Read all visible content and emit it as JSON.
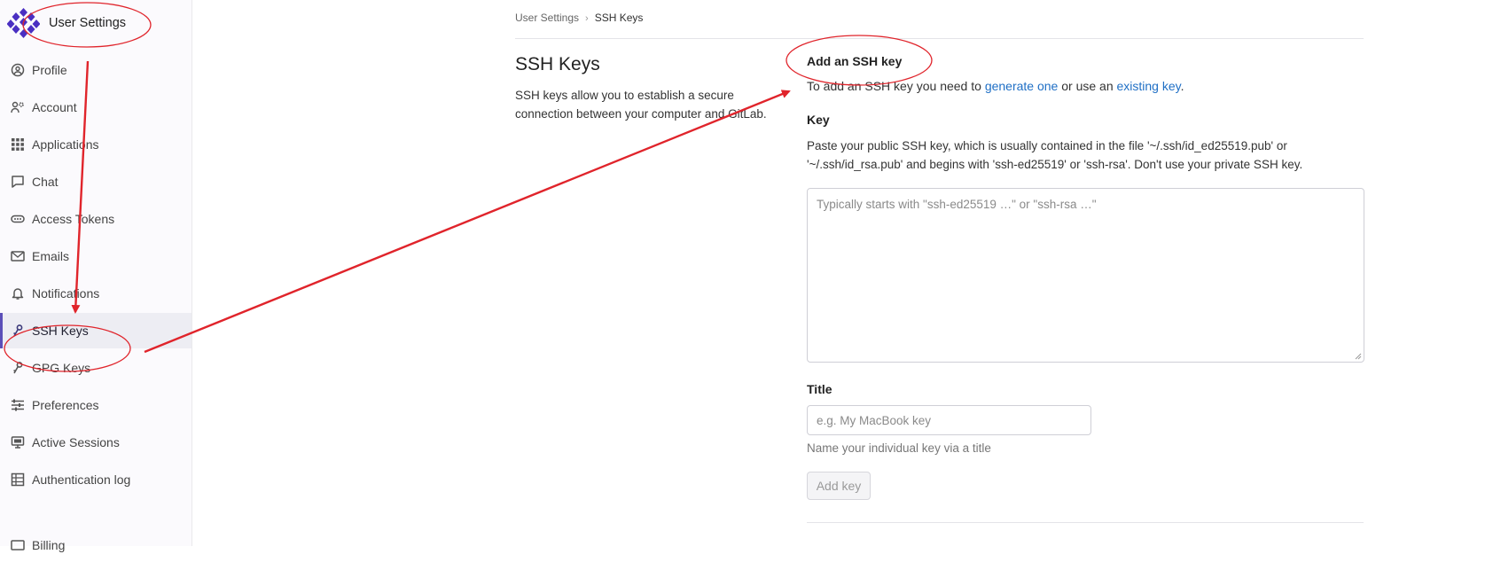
{
  "sidebar": {
    "title": "User Settings",
    "items": [
      {
        "label": "Profile",
        "icon": "profile-icon"
      },
      {
        "label": "Account",
        "icon": "account-icon"
      },
      {
        "label": "Applications",
        "icon": "applications-icon"
      },
      {
        "label": "Chat",
        "icon": "chat-icon"
      },
      {
        "label": "Access Tokens",
        "icon": "token-icon"
      },
      {
        "label": "Emails",
        "icon": "mail-icon"
      },
      {
        "label": "Notifications",
        "icon": "bell-icon"
      },
      {
        "label": "SSH Keys",
        "icon": "key-icon",
        "active": true
      },
      {
        "label": "GPG Keys",
        "icon": "key-icon"
      },
      {
        "label": "Preferences",
        "icon": "preferences-icon"
      },
      {
        "label": "Active Sessions",
        "icon": "monitor-icon"
      },
      {
        "label": "Authentication log",
        "icon": "log-icon"
      },
      {
        "label": "Billing",
        "icon": "billing-icon"
      }
    ]
  },
  "breadcrumb": {
    "parent": "User Settings",
    "separator": "›",
    "current": "SSH Keys"
  },
  "main": {
    "title": "SSH Keys",
    "description": "SSH keys allow you to establish a secure connection between your computer and GitLab.",
    "section_title": "Add an SSH key",
    "intro_prefix": "To add an SSH key you need to ",
    "link_generate": "generate one",
    "intro_mid": " or use an ",
    "link_existing": "existing key",
    "intro_suffix": ".",
    "key_label": "Key",
    "key_help": "Paste your public SSH key, which is usually contained in the file '~/.ssh/id_ed25519.pub' or '~/.ssh/id_rsa.pub' and begins with 'ssh-ed25519' or 'ssh-rsa'. Don't use your private SSH key.",
    "key_placeholder": "Typically starts with \"ssh-ed25519 …\" or \"ssh-rsa …\"",
    "title_label": "Title",
    "title_placeholder": "e.g. My MacBook key",
    "title_help": "Name your individual key via a title",
    "add_button": "Add key"
  },
  "colors": {
    "accent": "#5b4fb8",
    "link": "#1f6fc5",
    "annotation": "#e0242b"
  }
}
